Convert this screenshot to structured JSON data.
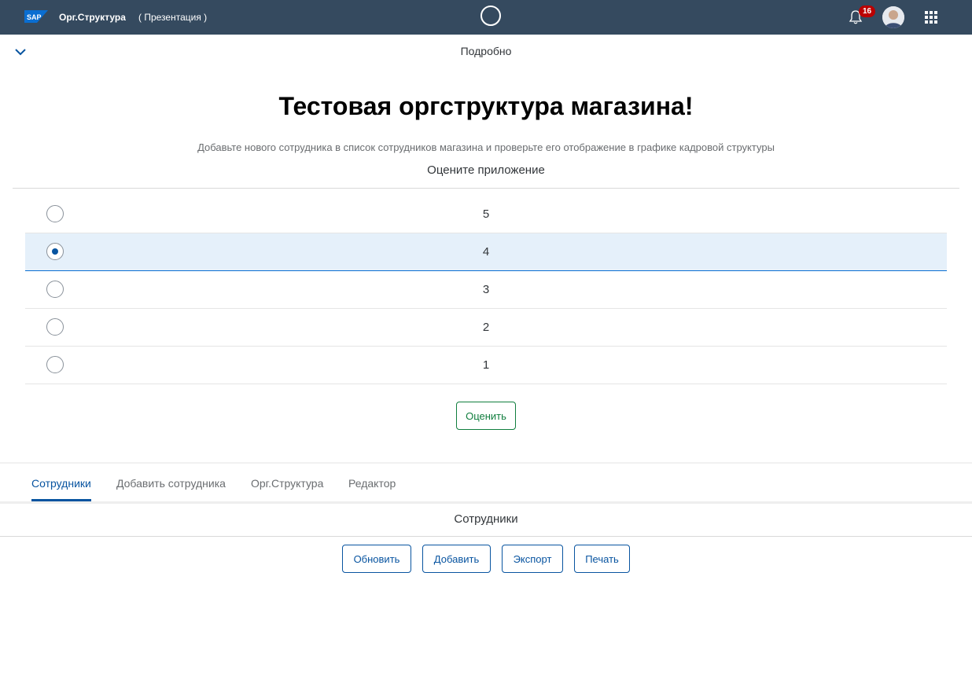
{
  "shell": {
    "logo_text": "SAP",
    "app_title": "Орг.Структура",
    "subtitle": "( Презентация )",
    "notifications_count": "16",
    "brand_color": "#354a5f"
  },
  "detail": {
    "label": "Подробно"
  },
  "main": {
    "title": "Тестовая оргструктура магазина!",
    "subtitle": "Добавьте нового сотрудника в список сотрудников магазина и проверьте его отображение в графике кадровой структуры",
    "rate_title": "Оцените приложение"
  },
  "rating": {
    "options": [
      {
        "label": "5",
        "selected": false
      },
      {
        "label": "4",
        "selected": true
      },
      {
        "label": "3",
        "selected": false
      },
      {
        "label": "2",
        "selected": false
      },
      {
        "label": "1",
        "selected": false
      }
    ],
    "button_label": "Оценить"
  },
  "tabs": [
    {
      "label": "Сотрудники",
      "active": true
    },
    {
      "label": "Добавить сотрудника",
      "active": false
    },
    {
      "label": "Орг.Структура",
      "active": false
    },
    {
      "label": "Редактор",
      "active": false
    }
  ],
  "table": {
    "title": "Сотрудники",
    "buttons": {
      "refresh": "Обновить",
      "add": "Добавить",
      "export": "Экспорт",
      "print": "Печать"
    }
  }
}
